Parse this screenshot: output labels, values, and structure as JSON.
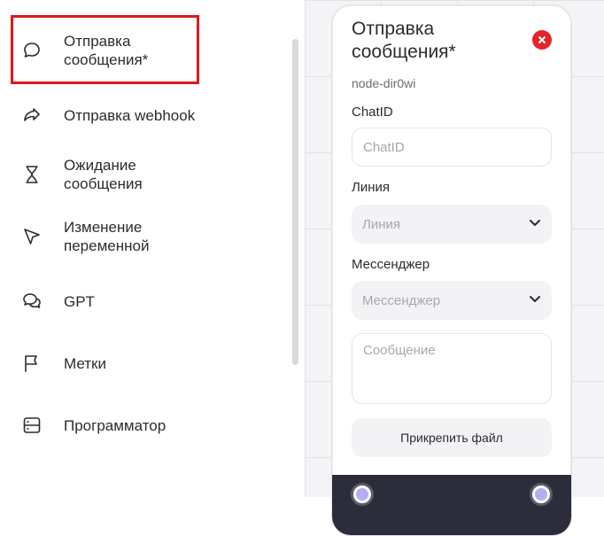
{
  "sidebar": {
    "items": [
      {
        "label": "Отправка\nсообщения*",
        "icon": "chat-bubble-icon"
      },
      {
        "label": "Отправка webhook",
        "icon": "share-arrow-icon"
      },
      {
        "label": "Ожидание\nсообщения",
        "icon": "hourglass-icon"
      },
      {
        "label": "Изменение\nпеременной",
        "icon": "cursor-arrow-icon"
      },
      {
        "label": "GPT",
        "icon": "chat-bubbles-icon"
      },
      {
        "label": "Метки",
        "icon": "flag-icon"
      },
      {
        "label": "Программатор",
        "icon": "server-icon"
      }
    ]
  },
  "node": {
    "title": "Отправка\nсообщения*",
    "id": "node-dir0wi",
    "chatid": {
      "label": "ChatID",
      "placeholder": "ChatID",
      "value": ""
    },
    "line": {
      "label": "Линия",
      "placeholder": "Линия"
    },
    "messenger": {
      "label": "Мессенджер",
      "placeholder": "Мессенджер"
    },
    "message": {
      "placeholder": "Сообщение",
      "value": ""
    },
    "attach_label": "Прикрепить файл"
  },
  "colors": {
    "accent_red": "#e3262b",
    "highlight_red": "#e0161e",
    "footer_dark": "#2c2d3a",
    "port_fill": "#b7abf2"
  }
}
